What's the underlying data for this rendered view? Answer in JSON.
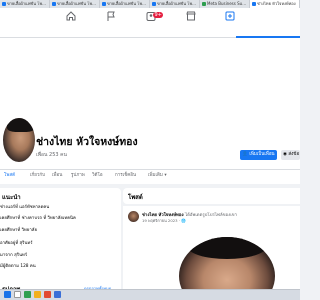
{
  "browser": {
    "tabs": [
      {
        "label": "ขายเสื้อผ้าแฟชั่น โพสต์ขาย",
        "active": false
      },
      {
        "label": "ขายเสื้อผ้าแฟชั่น โพสต์ขาย",
        "active": false
      },
      {
        "label": "ขายเสื้อผ้าแฟชั่น โพสต์ขาย",
        "active": false
      },
      {
        "label": "ขายเสื้อผ้าแฟชั่น โพสต์ขาย",
        "active": false
      },
      {
        "label": "Meta Business Suite",
        "active": false
      },
      {
        "label": "ช่างไทย หัวใจหงษ์ทอง",
        "active": true
      }
    ]
  },
  "navbar": {
    "icons": [
      "home-icon",
      "flag-icon",
      "groups-icon",
      "marketplace-icon",
      "gaming-icon"
    ],
    "notification_count": "9+"
  },
  "profile": {
    "name": "ช่างไทย หัวใจหงษ์ทอง",
    "friends": "เพื่อน 253 คน",
    "add_friend_label": "เพิ่มเป็นเพื่อน",
    "message_label": "ส่งข้อ",
    "tabs": [
      "โพสต์",
      "เกี่ยวกับ",
      "เพื่อน",
      "รูปภาพ",
      "วิดีโอ",
      "การเช็คอิน",
      "เพิ่มเติม ▾"
    ]
  },
  "intro": {
    "title": "แนะนำ",
    "lines": [
      "ช่างแอร์ที่ แอร์ทัชหาลดคน",
      "เคยศึกษาที่ ช่างคาบรถ ที่ วิทยาลัยเทคนิค",
      "เคยศึกษาที่ วิทยาลัย",
      "อาศัยอยู่ที่ สุรินทร์",
      "มาจาก สุรินทร์",
      "มีผู้ติดตาม 128 คน"
    ],
    "photos_title": "รูปภาพ",
    "photos_link": "ดูรูปภาพทั้งหมด"
  },
  "posts": {
    "title": "โพสต์",
    "author": "ช่างไทย หัวใจหงษ์ทอง",
    "action": "ได้อัพเดตรูปโปรไฟล์ของเขา",
    "time": "19 พฤศจิกายน 2023 · 🌐"
  },
  "colors": {
    "brand": "#1877f2",
    "background": "#f0f2f5",
    "badge": "#e41e3f"
  }
}
